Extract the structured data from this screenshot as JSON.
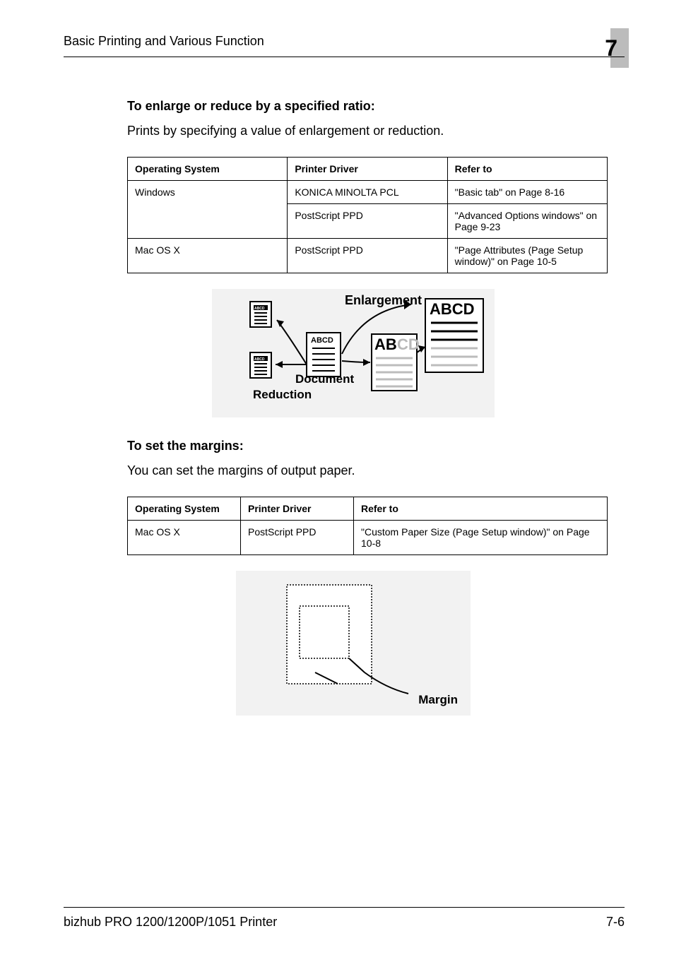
{
  "header": {
    "running_title": "Basic Printing and Various Function",
    "chapter_number": "7"
  },
  "section1": {
    "heading": "To enlarge or reduce by a specified ratio:",
    "paragraph": "Prints by specifying a value of enlargement or reduction.",
    "table": {
      "headers": [
        "Operating System",
        "Printer Driver",
        "Refer to"
      ],
      "rows": [
        [
          "Windows",
          "KONICA MINOLTA PCL",
          "\"Basic tab\" on Page 8-16"
        ],
        [
          "",
          "PostScript PPD",
          "\"Advanced Options windows\" on Page 9-23"
        ],
        [
          "Mac OS X",
          "PostScript PPD",
          "\"Page Attributes (Page Setup window)\" on Page 10-5"
        ]
      ]
    },
    "diagram": {
      "enlargement": "Enlargement",
      "document": "Document",
      "reduction": "Reduction",
      "abcd_big": "ABCD",
      "abcd_mid": "ABCD",
      "abcd_sm": "ABCD",
      "abcd_icon": "ABCD"
    }
  },
  "section2": {
    "heading": "To set the margins:",
    "paragraph": "You can set the margins of output paper.",
    "table": {
      "headers": [
        "Operating System",
        "Printer Driver",
        "Refer to"
      ],
      "rows": [
        [
          "Mac OS X",
          "PostScript PPD",
          "\"Custom Paper Size (Page Setup window)\" on Page 10-8"
        ]
      ]
    },
    "diagram": {
      "margin": "Margin"
    }
  },
  "footer": {
    "left": "bizhub PRO 1200/1200P/1051 Printer",
    "right": "7-6"
  }
}
